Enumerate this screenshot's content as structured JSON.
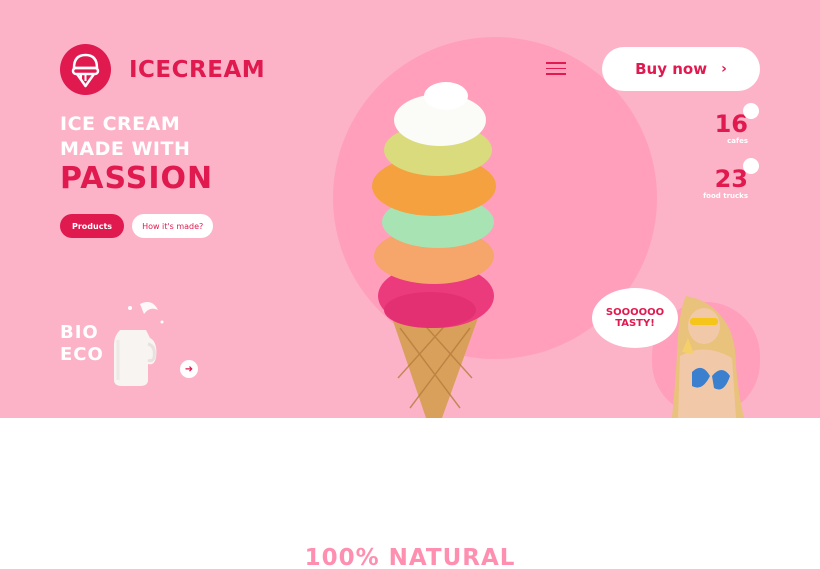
{
  "brand": {
    "name": "ICECREAM",
    "logo_icon": "ice-cream-logo-icon",
    "accent_color": "#e0194f",
    "hero_bg": "#fcb3c8"
  },
  "header": {
    "menu_icon": "hamburger-menu-icon",
    "buy_label": "Buy now",
    "buy_icon": "chevron-right-icon"
  },
  "hero": {
    "line1": "ICE CREAM",
    "line2": "MADE WITH",
    "line3": "PASSION",
    "products_label": "Products",
    "how_label": "How it's made?"
  },
  "stats": [
    {
      "value": "16",
      "label": "cafes"
    },
    {
      "value": "23",
      "label": "food trucks"
    }
  ],
  "bio": {
    "line1": "BIO",
    "line2": "ECO",
    "arrow_icon": "arrow-right-icon"
  },
  "bubble": {
    "line1": "SOOOOOO",
    "line2": "TASTY!"
  },
  "section": {
    "title": "100% NATURAL"
  }
}
